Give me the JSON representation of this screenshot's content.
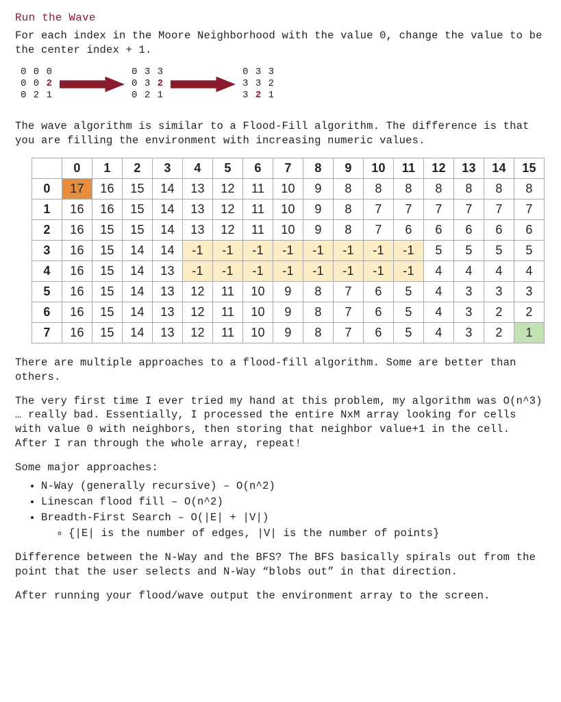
{
  "heading": "Run the Wave",
  "intro": "For each index in the Moore Neighborhood with the value 0, change the value to be the center index + 1.",
  "demo": {
    "grid1": [
      [
        "0",
        "0",
        "0"
      ],
      [
        "0",
        "0",
        "2"
      ],
      [
        "0",
        "2",
        "1"
      ]
    ],
    "grid1_bold": [
      [
        false,
        false,
        false
      ],
      [
        false,
        false,
        true
      ],
      [
        false,
        false,
        false
      ]
    ],
    "grid2": [
      [
        "0",
        "3",
        "3"
      ],
      [
        "0",
        "3",
        "2"
      ],
      [
        "0",
        "2",
        "1"
      ]
    ],
    "grid2_bold": [
      [
        false,
        false,
        false
      ],
      [
        false,
        false,
        true
      ],
      [
        false,
        false,
        false
      ]
    ],
    "grid3": [
      [
        "0",
        "3",
        "3"
      ],
      [
        "3",
        "3",
        "2"
      ],
      [
        "3",
        "2",
        "1"
      ]
    ],
    "grid3_bold": [
      [
        false,
        false,
        false
      ],
      [
        false,
        false,
        false
      ],
      [
        false,
        true,
        false
      ]
    ]
  },
  "para2": "The wave algorithm is similar to a Flood-Fill algorithm.  The difference is that you are filling the environment with increasing numeric values.",
  "chart_data": {
    "type": "table",
    "title": "Wavefront distance grid",
    "col_headers": [
      "0",
      "1",
      "2",
      "3",
      "4",
      "5",
      "6",
      "7",
      "8",
      "9",
      "10",
      "11",
      "12",
      "13",
      "14",
      "15"
    ],
    "row_headers": [
      "0",
      "1",
      "2",
      "3",
      "4",
      "5",
      "6",
      "7"
    ],
    "values": [
      [
        17,
        16,
        15,
        14,
        13,
        12,
        11,
        10,
        9,
        8,
        8,
        8,
        8,
        8,
        8,
        8
      ],
      [
        16,
        16,
        15,
        14,
        13,
        12,
        11,
        10,
        9,
        8,
        7,
        7,
        7,
        7,
        7,
        7
      ],
      [
        16,
        15,
        15,
        14,
        13,
        12,
        11,
        10,
        9,
        8,
        7,
        6,
        6,
        6,
        6,
        6
      ],
      [
        16,
        15,
        14,
        14,
        -1,
        -1,
        -1,
        -1,
        -1,
        -1,
        -1,
        -1,
        5,
        5,
        5,
        5
      ],
      [
        16,
        15,
        14,
        13,
        -1,
        -1,
        -1,
        -1,
        -1,
        -1,
        -1,
        -1,
        4,
        4,
        4,
        4
      ],
      [
        16,
        15,
        14,
        13,
        12,
        11,
        10,
        9,
        8,
        7,
        6,
        5,
        4,
        3,
        3,
        3
      ],
      [
        16,
        15,
        14,
        13,
        12,
        11,
        10,
        9,
        8,
        7,
        6,
        5,
        4,
        3,
        2,
        2
      ],
      [
        16,
        15,
        14,
        13,
        12,
        11,
        10,
        9,
        8,
        7,
        6,
        5,
        4,
        3,
        2,
        1
      ]
    ],
    "highlights": {
      "orange": [
        [
          0,
          0
        ]
      ],
      "yellow_rows": {
        "rows": [
          3,
          4
        ],
        "cols_from": 4,
        "cols_to": 11
      },
      "green": [
        [
          7,
          15
        ]
      ]
    }
  },
  "para3": "There are multiple approaches to a flood-fill algorithm.  Some are better than others.",
  "para4": "The very first time I ever tried my hand at this problem, my algorithm was O(n^3) … really bad.  Essentially, I processed the entire NxM array looking for cells with value 0 with neighbors, then storing that neighbor value+1 in the cell.  After I ran through the whole array, repeat!",
  "para5": "Some major approaches:",
  "bullets": [
    "N-Way (generally recursive) – O(n^2)",
    "Linescan flood fill – O(n^2)",
    "Breadth-First Search – O(|E| + |V|)"
  ],
  "sub_bullet": "{|E| is the number of edges, |V| is the number of points}",
  "para6": "Difference between the N-Way and the BFS?  The BFS basically spirals out from the point that the user selects and N-Way “blobs out” in that direction.",
  "para7": "After running your flood/wave output the environment array to the screen."
}
